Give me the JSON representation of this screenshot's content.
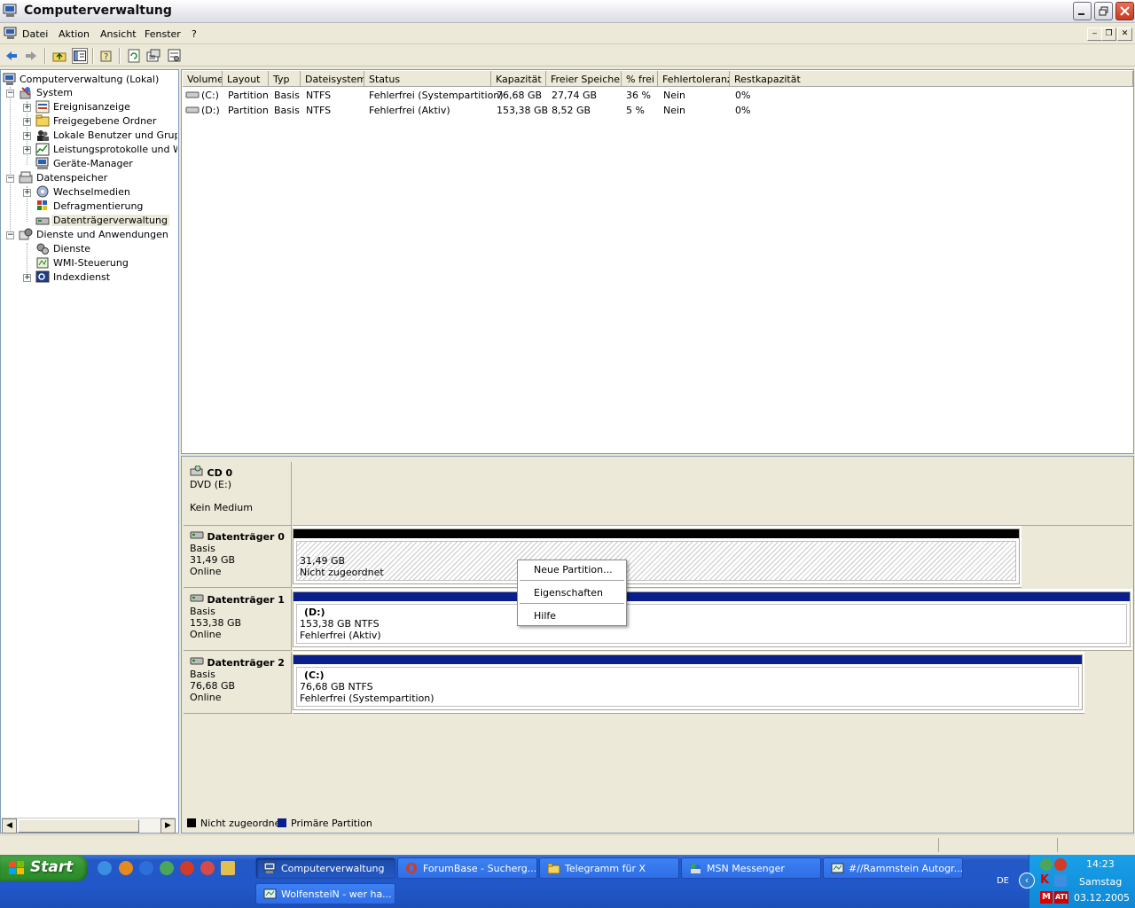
{
  "window": {
    "title": "Computerverwaltung"
  },
  "menu": {
    "items": [
      "Datei",
      "Aktion",
      "Ansicht",
      "Fenster",
      "?"
    ]
  },
  "tree": {
    "root": "Computerverwaltung (Lokal)",
    "nodes": [
      {
        "label": "System",
        "icon": "tools-icon"
      },
      {
        "label": "Ereignisanzeige",
        "icon": "event-viewer-icon"
      },
      {
        "label": "Freigegebene Ordner",
        "icon": "shared-folder-icon"
      },
      {
        "label": "Lokale Benutzer und Gruppen",
        "icon": "users-icon"
      },
      {
        "label": "Leistungsprotokolle und Warnungen",
        "icon": "performance-icon"
      },
      {
        "label": "Geräte-Manager",
        "icon": "device-manager-icon"
      },
      {
        "label": "Datenspeicher",
        "icon": "storage-icon"
      },
      {
        "label": "Wechselmedien",
        "icon": "removable-media-icon"
      },
      {
        "label": "Defragmentierung",
        "icon": "defrag-icon"
      },
      {
        "label": "Datenträgerverwaltung",
        "icon": "disk-management-icon"
      },
      {
        "label": "Dienste und Anwendungen",
        "icon": "services-apps-icon"
      },
      {
        "label": "Dienste",
        "icon": "services-icon"
      },
      {
        "label": "WMI-Steuerung",
        "icon": "wmi-icon"
      },
      {
        "label": "Indexdienst",
        "icon": "index-service-icon"
      }
    ]
  },
  "volumes": {
    "columns": [
      "Volume",
      "Layout",
      "Typ",
      "Dateisystem",
      "Status",
      "Kapazität",
      "Freier Speicher",
      "% frei",
      "Fehlertoleranz",
      "Restkapazität"
    ],
    "rows": [
      [
        "(C:)",
        "Partition",
        "Basis",
        "NTFS",
        "Fehlerfrei (Systempartition)",
        "76,68 GB",
        "27,74 GB",
        "36 %",
        "Nein",
        "0%"
      ],
      [
        "(D:)",
        "Partition",
        "Basis",
        "NTFS",
        "Fehlerfrei (Aktiv)",
        "153,38 GB",
        "8,52 GB",
        "5 %",
        "Nein",
        "0%"
      ]
    ]
  },
  "disks": [
    {
      "name": "CD 0",
      "line1": "DVD (E:)",
      "line2": "",
      "line3": "Kein Medium"
    },
    {
      "name": "Datenträger 0",
      "line1": "Basis",
      "line2": "31,49 GB",
      "line3": "Online",
      "partition": {
        "drive": "",
        "size": "31,49 GB",
        "status": "Nicht zugeordnet"
      }
    },
    {
      "name": "Datenträger 1",
      "line1": "Basis",
      "line2": "153,38 GB",
      "line3": "Online",
      "partition": {
        "drive": "(D:)",
        "size": "153,38 GB NTFS",
        "status": "Fehlerfrei (Aktiv)"
      }
    },
    {
      "name": "Datenträger 2",
      "line1": "Basis",
      "line2": "76,68 GB",
      "line3": "Online",
      "partition": {
        "drive": "(C:)",
        "size": "76,68 GB NTFS",
        "status": "Fehlerfrei (Systempartition)"
      }
    }
  ],
  "legend": {
    "unallocated": "Nicht zugeordnet",
    "primary": "Primäre Partition"
  },
  "context_menu": {
    "items": [
      "Neue Partition...",
      "Eigenschaften",
      "Hilfe"
    ]
  },
  "taskbar": {
    "start": "Start",
    "tasks": [
      "Computerverwaltung",
      "ForumBase - Sucherg...",
      "Telegramm für X",
      "MSN Messenger",
      "#//Rammstein Autogr...",
      "WolfensteiN - wer ha..."
    ],
    "language": "DE",
    "time": "14:23",
    "day": "Samstag",
    "date": "03.12.2005"
  },
  "colors": {
    "unallocated": "#000000",
    "primary": "#0a1e8c",
    "taskbar": "#2457c8",
    "tray": "#109ad8"
  }
}
